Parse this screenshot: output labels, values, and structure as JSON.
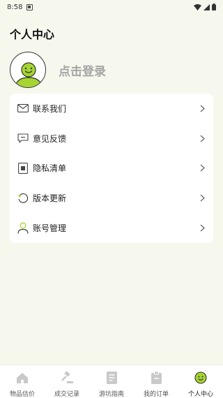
{
  "status_bar": {
    "time": "8:58"
  },
  "header": {
    "title": "个人中心"
  },
  "profile": {
    "login_label": "点击登录"
  },
  "menu": {
    "items": [
      {
        "label": "联系我们",
        "icon": "mail-icon"
      },
      {
        "label": "意见反馈",
        "icon": "feedback-icon"
      },
      {
        "label": "隐私清单",
        "icon": "privacy-icon"
      },
      {
        "label": "版本更新",
        "icon": "refresh-icon"
      },
      {
        "label": "账号管理",
        "icon": "user-icon"
      }
    ]
  },
  "tabbar": {
    "tabs": [
      {
        "label": "物品估价",
        "icon": "home-icon"
      },
      {
        "label": "成交记录",
        "icon": "gavel-icon"
      },
      {
        "label": "游坑指南",
        "icon": "guide-icon"
      },
      {
        "label": "我的订单",
        "icon": "order-icon"
      },
      {
        "label": "个人中心",
        "icon": "smile-icon",
        "active": true
      }
    ]
  },
  "colors": {
    "accent": "#a6d430",
    "background": "#f6f8ee",
    "muted_text": "#a5a5a5"
  }
}
